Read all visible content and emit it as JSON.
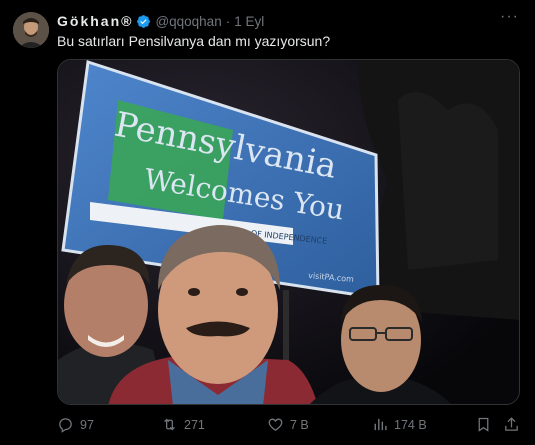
{
  "tweet": {
    "author_name": "Gökhan®",
    "handle": "@qqoqhan",
    "separator": "·",
    "time": "1 Eyl",
    "more_glyph": "···",
    "text": "Bu satırları Pensilvanya dan mı yazıyorsun?",
    "sign": {
      "line1": "Pennsylvania",
      "line2": "Welcomes You",
      "strip": "...OF INDEPENDENCE",
      "site": "visitPA.com"
    },
    "stats": {
      "replies": "97",
      "reposts": "271",
      "likes": "7 B",
      "views": "174 B"
    }
  },
  "colors": {
    "background": "#000000",
    "text": "#e7e9ea",
    "muted": "#71767b",
    "verified": "#1d9bf0",
    "sign_blue": "#3a6fb5"
  },
  "icons": [
    "verified-badge-icon",
    "reply-icon",
    "repost-icon",
    "like-icon",
    "views-icon",
    "bookmark-icon",
    "share-icon"
  ]
}
